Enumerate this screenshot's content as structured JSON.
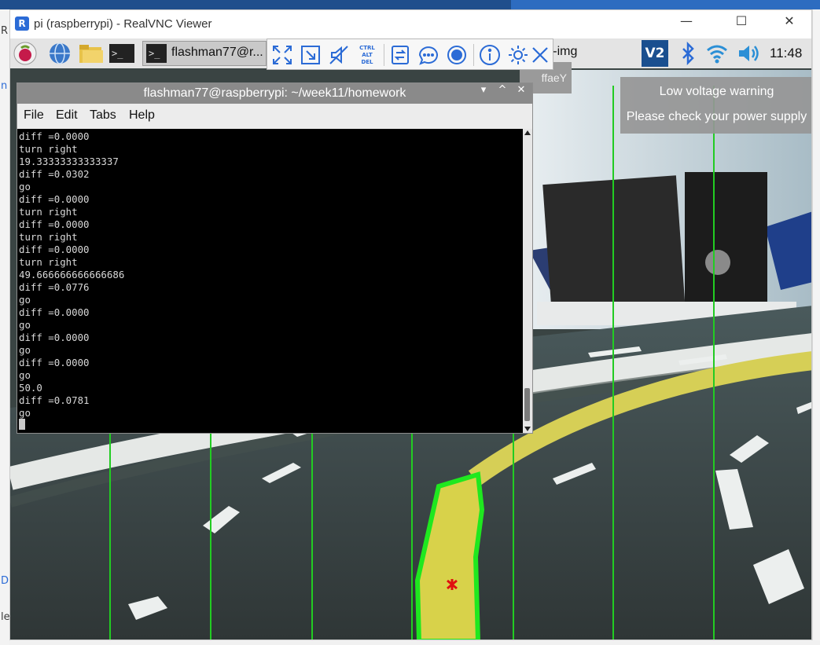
{
  "host": {
    "left_edge_letters": [
      "R",
      "n",
      "D",
      "le"
    ]
  },
  "window": {
    "title": "pi (raspberrypi) - RealVNC Viewer",
    "minimize_glyph": "—",
    "maximize_glyph": "☐",
    "close_glyph": "✕",
    "logo_glyph": "R"
  },
  "pi_taskbar": {
    "launchers": [
      "raspberry-menu-icon",
      "web-browser-icon",
      "file-manager-icon",
      "terminal-icon"
    ],
    "terminal_glyph": ">_",
    "tasks": [
      {
        "label": "flashman77@r..."
      },
      {
        "label": "...n-img"
      }
    ],
    "tray": {
      "vnc_glyph": "V2",
      "clock": "11:48"
    }
  },
  "vnc_toolbar": {
    "buttons": [
      "full-screen-icon",
      "scale-icon",
      "audio-muted-icon",
      "ctrl-alt-del-icon",
      "file-transfer-icon",
      "chat-icon",
      "record-icon",
      "info-icon",
      "settings-icon",
      "close-toolbar-icon"
    ],
    "ctrl_alt_del_lines": [
      "CTRL",
      "ALT",
      "DEL"
    ]
  },
  "hidden_tooltip_text": "ffaeY",
  "low_voltage": {
    "line1": "Low voltage warning",
    "line2": "Please check your power supply"
  },
  "terminal": {
    "title": "flashman77@raspberrypi: ~/week11/homework",
    "controls": [
      "▾",
      "^",
      "✕"
    ],
    "menu": [
      "File",
      "Edit",
      "Tabs",
      "Help"
    ],
    "lines": [
      "diff =0.0000",
      "turn right",
      "19.33333333333337",
      "diff =0.0302",
      "go",
      "diff =0.0000",
      "turn right",
      "diff =0.0000",
      "turn right",
      "diff =0.0000",
      "turn right",
      "49.666666666666686",
      "diff =0.0776",
      "go",
      "diff =0.0000",
      "go",
      "diff =0.0000",
      "go",
      "diff =0.0000",
      "go",
      "50.0",
      "diff =0.0781",
      "go"
    ]
  },
  "camera": {
    "guide_line_color": "#22cc22",
    "lane_color": "#d8d24a",
    "marker_color": "#e01010"
  }
}
